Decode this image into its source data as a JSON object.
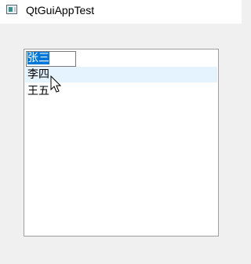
{
  "window": {
    "title": "QtGuiAppTest",
    "icon": "app-window-icon"
  },
  "list": {
    "editing_item": {
      "value": "张三",
      "selected": true
    },
    "items": [
      {
        "label": "张三",
        "state": "editing"
      },
      {
        "label": "李四",
        "state": "hover"
      },
      {
        "label": "王五",
        "state": "normal"
      }
    ]
  },
  "colors": {
    "selection": "#0078d7",
    "hover": "#e5f3ff",
    "list_border": "#a0a0a0",
    "window_bg": "#f0f0f0"
  },
  "cursor": {
    "icon": "mouse-pointer-icon"
  }
}
